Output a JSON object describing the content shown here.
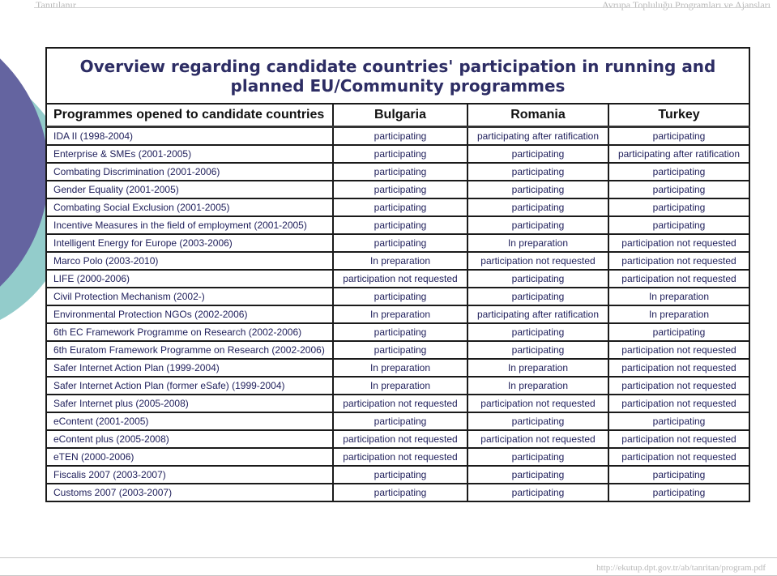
{
  "page_header": {
    "left": "Tanıtılanır",
    "right": "Avrupa Topluluğu Programları ve Ajansları"
  },
  "slide": {
    "title_line1": "Overview regarding candidate countries' participation in running and",
    "title_line2": "planned EU/Community programmes"
  },
  "table": {
    "headers": [
      "Programmes opened to candidate countries",
      "Bulgaria",
      "Romania",
      "Turkey"
    ],
    "rows": [
      {
        "programme": "IDA II (1998-2004)",
        "bulgaria": "participating",
        "romania": "participating after ratification",
        "turkey": "participating"
      },
      {
        "programme": "Enterprise & SMEs (2001-2005)",
        "bulgaria": "participating",
        "romania": "participating",
        "turkey": "participating after ratification"
      },
      {
        "programme": "Combating Discrimination (2001-2006)",
        "bulgaria": "participating",
        "romania": "participating",
        "turkey": "participating"
      },
      {
        "programme": "Gender Equality (2001-2005)",
        "bulgaria": "participating",
        "romania": "participating",
        "turkey": "participating"
      },
      {
        "programme": "Combating Social Exclusion (2001-2005)",
        "bulgaria": "participating",
        "romania": "participating",
        "turkey": "participating"
      },
      {
        "programme": "Incentive Measures in the field of employment (2001-2005)",
        "bulgaria": "participating",
        "romania": "participating",
        "turkey": "participating"
      },
      {
        "programme": "Intelligent Energy for Europe (2003-2006)",
        "bulgaria": "participating",
        "romania": "In preparation",
        "turkey": "participation not requested"
      },
      {
        "programme": "Marco Polo (2003-2010)",
        "bulgaria": "In preparation",
        "romania": "participation not requested",
        "turkey": "participation not requested"
      },
      {
        "programme": "LIFE (2000-2006)",
        "bulgaria": "participation not requested",
        "romania": "participating",
        "turkey": "participation not requested"
      },
      {
        "programme": "Civil Protection Mechanism (2002-)",
        "bulgaria": "participating",
        "romania": "participating",
        "turkey": "In preparation"
      },
      {
        "programme": "Environmental Protection NGOs (2002-2006)",
        "bulgaria": "In preparation",
        "romania": "participating after ratification",
        "turkey": "In preparation"
      },
      {
        "programme": "6th EC Framework Programme on Research (2002-2006)",
        "bulgaria": "participating",
        "romania": "participating",
        "turkey": "participating"
      },
      {
        "programme": "6th Euratom Framework Programme on Research (2002-2006)",
        "bulgaria": "participating",
        "romania": "participating",
        "turkey": "participation not requested"
      },
      {
        "programme": "Safer Internet Action Plan  (1999-2004)",
        "bulgaria": "In preparation",
        "romania": "In preparation",
        "turkey": "participation not requested"
      },
      {
        "programme": "Safer Internet Action Plan (former eSafe) (1999-2004)",
        "bulgaria": "In preparation",
        "romania": "In preparation",
        "turkey": "participation not requested"
      },
      {
        "programme": "Safer Internet plus (2005-2008)",
        "bulgaria": "participation not requested",
        "romania": "participation not requested",
        "turkey": "participation not requested"
      },
      {
        "programme": "eContent (2001-2005)",
        "bulgaria": "participating",
        "romania": "participating",
        "turkey": "participating"
      },
      {
        "programme": "eContent plus (2005-2008)",
        "bulgaria": "participation not requested",
        "romania": "participation not requested",
        "turkey": "participation not requested"
      },
      {
        "programme": "eTEN (2000-2006)",
        "bulgaria": "participation not requested",
        "romania": "participating",
        "turkey": "participation not requested"
      },
      {
        "programme": "Fiscalis 2007 (2003-2007)",
        "bulgaria": "participating",
        "romania": "participating",
        "turkey": "participating"
      },
      {
        "programme": "Customs 2007 (2003-2007)",
        "bulgaria": "participating",
        "romania": "participating",
        "turkey": "participating"
      }
    ]
  },
  "footer": {
    "url": "http://ekutup.dpt.gov.tr/ab/tanritan/program.pdf"
  },
  "colors": {
    "title": "#2d2d64",
    "cell_text": "#1e1e5a",
    "deco_purple": "#6464a0",
    "deco_teal": "#93cccb"
  }
}
